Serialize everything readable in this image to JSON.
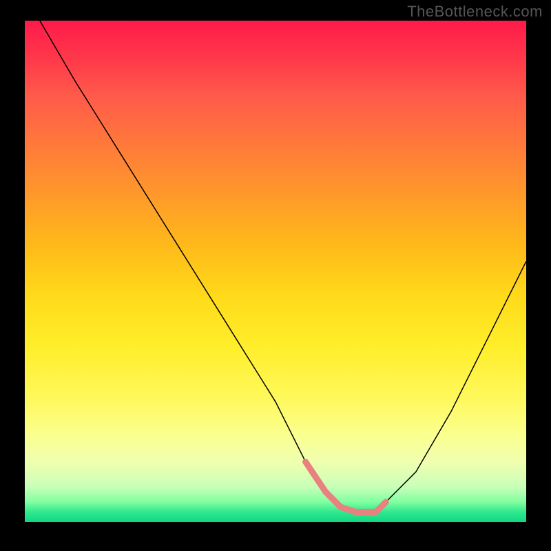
{
  "watermark": "TheBottleneck.com",
  "chart_data": {
    "type": "line",
    "title": "",
    "xlabel": "",
    "ylabel": "",
    "xlim": [
      0,
      100
    ],
    "ylim": [
      0,
      100
    ],
    "grid": false,
    "legend": false,
    "series": [
      {
        "name": "curve",
        "x": [
          3,
          10,
          20,
          30,
          40,
          50,
          56,
          60,
          63,
          66,
          70,
          72,
          78,
          85,
          92,
          100
        ],
        "values": [
          100,
          88,
          72,
          56,
          40,
          24,
          12,
          6,
          3,
          2,
          2,
          4,
          10,
          22,
          36,
          52
        ]
      }
    ],
    "colors": {
      "gradient_top": "#ff1a4a",
      "gradient_mid": "#ffee2a",
      "gradient_bottom": "#10d880",
      "curve": "#000000",
      "low_segment": "#e8817f"
    },
    "low_segment": {
      "x_range": [
        56,
        72
      ],
      "description": "bottom of V-curve highlighted in salmon with dot markers"
    }
  }
}
